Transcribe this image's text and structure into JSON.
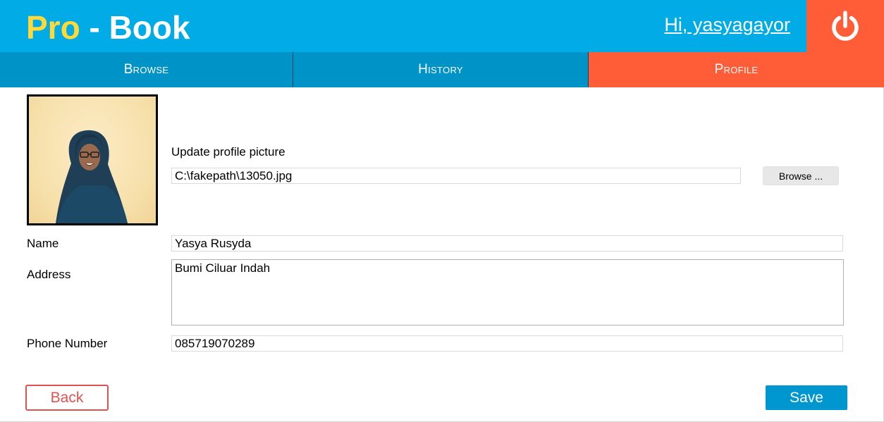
{
  "header": {
    "logo_pro": "Pro",
    "logo_rest": " - Book",
    "greeting": "Hi, yasyagayor",
    "logout_icon": "power-icon"
  },
  "nav": {
    "tabs": [
      {
        "label": "Browse",
        "active": false
      },
      {
        "label": "History",
        "active": false
      },
      {
        "label": "Profile",
        "active": true
      }
    ]
  },
  "profile": {
    "avatar_alt": "profile-photo",
    "update_picture_label": "Update profile picture",
    "file_path": "C:\\fakepath\\13050.jpg",
    "browse_label": "Browse ...",
    "name_label": "Name",
    "name_value": "Yasya Rusyda",
    "address_label": "Address",
    "address_value": "Bumi Ciluar Indah",
    "phone_label": "Phone Number",
    "phone_value": "085719070289"
  },
  "actions": {
    "back_label": "Back",
    "save_label": "Save"
  },
  "colors": {
    "header_bg": "#00ABE6",
    "nav_bg": "#0093C7",
    "accent": "#FF5C38",
    "logo_yellow": "#FFD93A",
    "back_red": "#E05252",
    "save_blue": "#0096CF"
  }
}
